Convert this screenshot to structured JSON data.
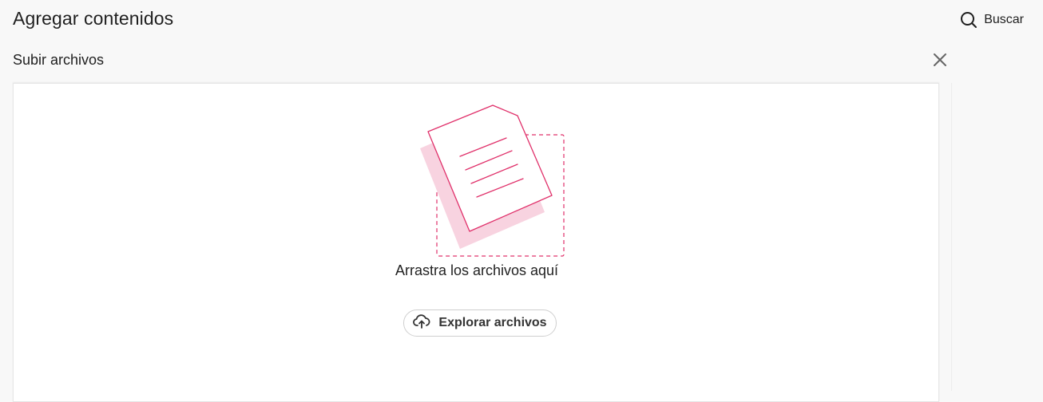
{
  "header": {
    "title": "Agregar contenidos",
    "search_label": "Buscar"
  },
  "upload": {
    "section_title": "Subir archivos",
    "drop_text": "Arrastra los archivos aquí",
    "browse_label": "Explorar archivos"
  },
  "icons": {
    "search": "search-icon",
    "close": "close-icon",
    "upload": "cloud-upload-icon",
    "illustration": "document-drop-illustration"
  },
  "colors": {
    "accent": "#e0306a",
    "accent_light": "#f8d3e0"
  }
}
